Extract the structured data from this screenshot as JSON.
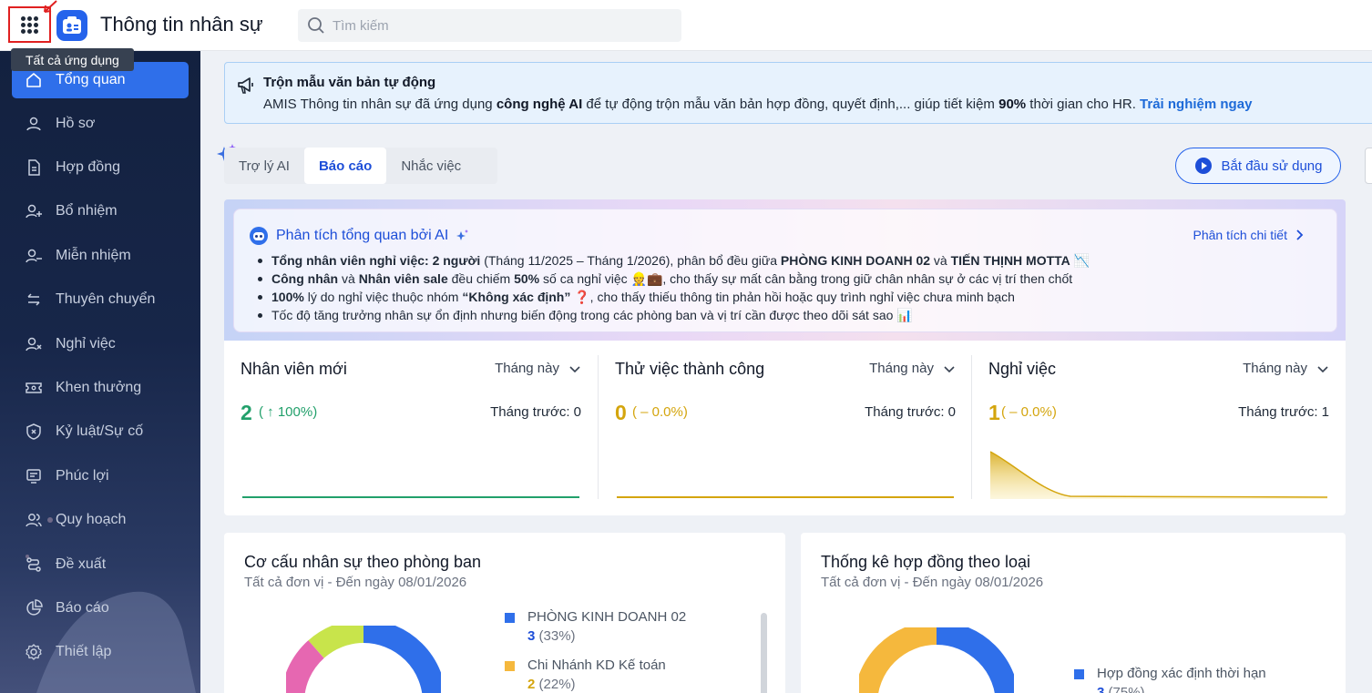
{
  "app": {
    "title": "Thông tin nhân sự",
    "tooltip": "Tất cả ứng dụng"
  },
  "search": {
    "placeholder": "Tìm kiếm"
  },
  "sidebar": {
    "items": [
      {
        "label": "Tổng quan",
        "icon": "home-icon",
        "active": true
      },
      {
        "label": "Hồ sơ",
        "icon": "user-icon"
      },
      {
        "label": "Hợp đồng",
        "icon": "document-icon"
      },
      {
        "label": "Bổ nhiệm",
        "icon": "user-plus-icon"
      },
      {
        "label": "Miễn nhiệm",
        "icon": "user-minus-icon"
      },
      {
        "label": "Thuyên chuyển",
        "icon": "transfer-icon"
      },
      {
        "label": "Nghỉ việc",
        "icon": "user-x-icon"
      },
      {
        "label": "Khen thưởng",
        "icon": "ticket-icon"
      },
      {
        "label": "Kỷ luật/Sự cố",
        "icon": "shield-x-icon"
      },
      {
        "label": "Phúc lợi",
        "icon": "benefit-icon"
      },
      {
        "label": "Quy hoạch",
        "icon": "users-icon"
      },
      {
        "label": "Đề xuất",
        "icon": "route-icon"
      },
      {
        "label": "Báo cáo",
        "icon": "pie-chart-icon"
      },
      {
        "label": "Thiết lập",
        "icon": "gear-icon"
      }
    ]
  },
  "banner": {
    "title": "Trộn mẫu văn bản tự động",
    "text_1": "AMIS Thông tin nhân sự đã ứng dụng ",
    "text_bold_1": "công nghệ AI",
    "text_2": " để tự động trộn mẫu văn bản hợp đồng, quyết định,... giúp tiết kiệm ",
    "text_bold_2": "90%",
    "text_3": " thời gian cho HR. ",
    "link": "Trải nghiệm ngay"
  },
  "tabs": [
    {
      "label": "Trợ lý AI"
    },
    {
      "label": "Báo cáo",
      "active": true
    },
    {
      "label": "Nhắc việc"
    }
  ],
  "start_button": "Bắt đầu sử dụng",
  "ai_panel": {
    "title": "Phân tích tổng quan bởi AI",
    "detail_link": "Phân tích chi tiết",
    "bullets": [
      {
        "b1": "Tổng nhân viên nghỉ việc: 2 người",
        "t1": " (Tháng 11/2025 – Tháng 1/2026), phân bổ đều giữa ",
        "b2": "PHÒNG KINH DOANH 02",
        "t2": " và ",
        "b3": "TIẾN THỊNH MOTTA",
        "t3": " 📉"
      },
      {
        "b1": "Công nhân",
        "t1": " và ",
        "b2": "Nhân viên sale",
        "t2": " đều chiếm ",
        "b3": "50%",
        "t3": " số ca nghỉ việc 👷💼, cho thấy sự mất cân bằng trong giữ chân nhân sự ở các vị trí then chốt"
      },
      {
        "b1": "100%",
        "t1": " lý do nghỉ việc thuộc nhóm ",
        "b2": "“Không xác định”",
        "t2": " ❓, cho thấy thiếu thông tin phản hồi hoặc quy trình nghỉ việc chưa minh bạch",
        "b3": "",
        "t3": ""
      },
      {
        "b1": "",
        "t1": "Tốc độ tăng trưởng nhân sự ổn định nhưng biến động trong các phòng ban và vị trí cần được theo dõi sát sao 📊",
        "b2": "",
        "t2": "",
        "b3": "",
        "t3": ""
      }
    ]
  },
  "kpis": [
    {
      "title": "Nhân viên mới",
      "period": "Tháng này",
      "value": "2",
      "change": "( ↑ 100%)",
      "prev": "Tháng trước: 0",
      "color": "#22a06b"
    },
    {
      "title": "Thử việc thành công",
      "period": "Tháng này",
      "value": "0",
      "change": "( – 0.0%)",
      "prev": "Tháng trước: 0",
      "color": "#d4a50d"
    },
    {
      "title": "Nghỉ việc",
      "period": "Tháng này",
      "value": "1",
      "change": "( – 0.0%)",
      "prev": "Tháng trước: 1",
      "color": "#d4a50d"
    }
  ],
  "cards": {
    "department": {
      "title": "Cơ cấu nhân sự theo phòng ban",
      "subtitle": "Tất cả đơn vị - Đến ngày 08/01/2026",
      "legend": [
        {
          "name": "PHÒNG KINH DOANH 02",
          "count": "3",
          "percent": "(33%)",
          "color": "#2f6fea"
        },
        {
          "name": "Chi Nhánh KD Kế toán",
          "count": "2",
          "percent": "(22%)",
          "color": "#f5b83d"
        }
      ]
    },
    "contract": {
      "title": "Thống kê hợp đồng theo loại",
      "subtitle": "Tất cả đơn vị - Đến ngày 08/01/2026",
      "legend": [
        {
          "name": "Hợp đồng xác định thời hạn",
          "count": "3",
          "percent": "(75%)",
          "color": "#2f6fea"
        }
      ]
    }
  },
  "colors": {
    "accent": "#2f6fea",
    "sidebar": "#172649"
  }
}
